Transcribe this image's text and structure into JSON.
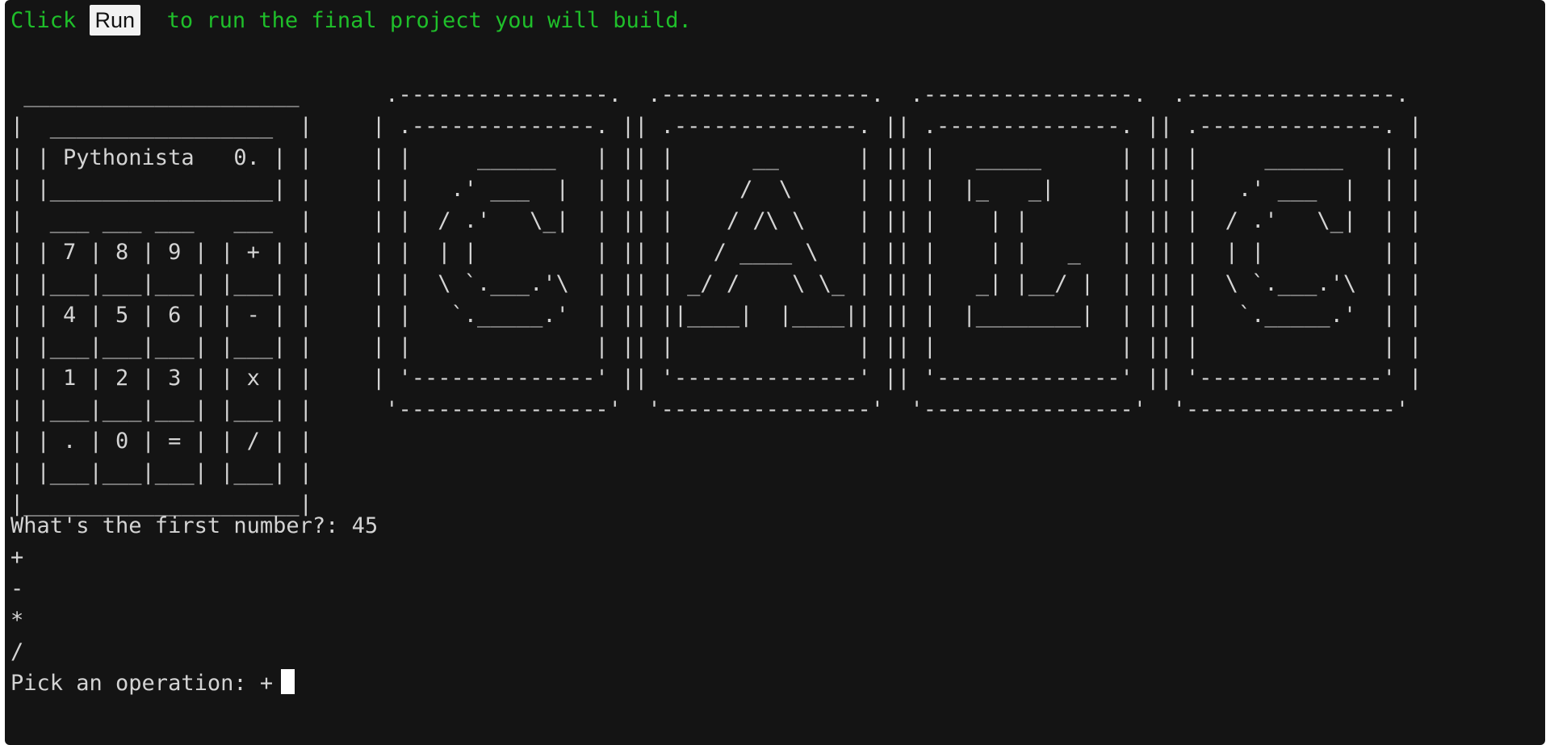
{
  "terminal": {
    "instruction": {
      "before": "Click ",
      "run_label": "Run",
      "after": "  to run the final project you will build."
    },
    "calculator_art": " _____________________\n|  _________________  |\n| | Pythonista   0. | |\n| |_________________| |\n|  ___ ___ ___   ___  |\n| | 7 | 8 | 9 | | + | |\n| |___|___|___| |___| |\n| | 4 | 5 | 6 | | - | |\n| |___|___|___| |___| |\n| | 1 | 2 | 3 | | x | |\n| |___|___|___| |___| |\n| | . | 0 | = | | / | |\n| |___|___|___| |___| |\n|_____________________|",
    "letters_art": " .----------------.  .----------------.  .----------------.  .----------------.\n| .--------------. || .--------------. || .--------------. || .--------------. |\n| |     ______   | || |      __      | || |   _____      | || |     ______   | |\n| |   .' ___  |  | || |     /  \\     | || |  |_   _|     | || |   .' ___  |  | |\n| |  / .'   \\_|  | || |    / /\\ \\    | || |    | |       | || |  / .'   \\_|  | |\n| |  | |         | || |   / ____ \\   | || |    | |   _   | || |  | |         | |\n| |  \\ `.___.'\\  | || | _/ /    \\ \\_ | || |   _| |__/ |  | || |  \\ `.___.'\\  | |\n| |   `._____.'  | || ||____|  |____|| || |  |________|  | || |   `._____.'  | |\n| |              | || |              | || |              | || |              | |\n| '--------------' || '--------------' || '--------------' || '--------------' |\n '----------------'  '----------------'  '----------------'  '----------------'",
    "first_number_prompt": "What's the first number?: 45",
    "operations": [
      "+",
      "-",
      "*",
      "/"
    ],
    "operation_prompt": "Pick an operation: +"
  }
}
